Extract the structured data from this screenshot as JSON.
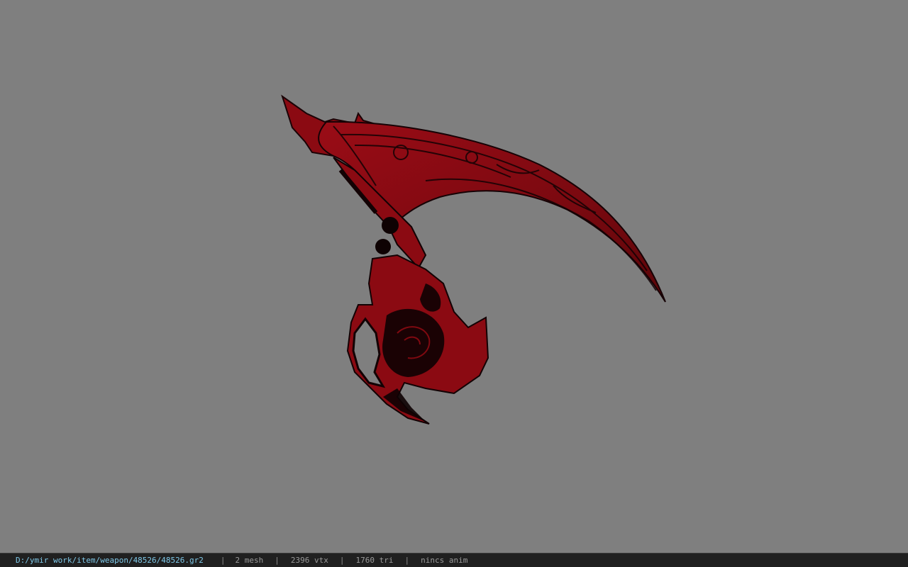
{
  "status_bar": {
    "file_path": "D:/ymir work/item/weapon/48526/48526.gr2",
    "separator": "|",
    "mesh_count": "2 mesh",
    "vertex_count": "2396 vtx",
    "triangle_count": "1760 tri",
    "anim_status": "nincs anim"
  },
  "colors": {
    "viewport_background": "#7f7f7f",
    "model_primary": "#8b0a12",
    "model_dark": "#0e0203",
    "status_bar_background": "#202020",
    "path_text": "#7fc8e8"
  }
}
